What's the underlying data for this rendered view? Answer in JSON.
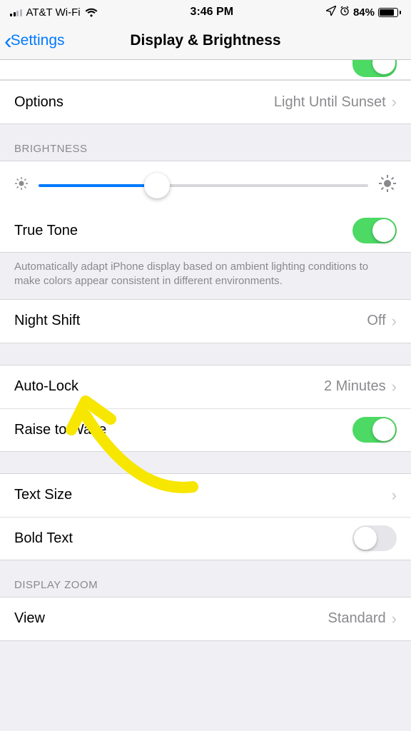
{
  "status": {
    "carrier": "AT&T Wi-Fi",
    "time": "3:46 PM",
    "battery_pct": "84%"
  },
  "nav": {
    "back_label": "Settings",
    "title": "Display & Brightness"
  },
  "rows": {
    "options": {
      "label": "Options",
      "value": "Light Until Sunset"
    },
    "brightness_header": "BRIGHTNESS",
    "brightness_pct": 36,
    "true_tone": {
      "label": "True Tone",
      "on": true
    },
    "true_tone_footer": "Automatically adapt iPhone display based on ambient lighting conditions to make colors appear consistent in different environments.",
    "night_shift": {
      "label": "Night Shift",
      "value": "Off"
    },
    "auto_lock": {
      "label": "Auto-Lock",
      "value": "2 Minutes"
    },
    "raise_to_wake": {
      "label": "Raise to Wake",
      "on": true
    },
    "text_size": {
      "label": "Text Size"
    },
    "bold_text": {
      "label": "Bold Text",
      "on": false
    },
    "display_zoom_header": "DISPLAY ZOOM",
    "view": {
      "label": "View",
      "value": "Standard"
    }
  }
}
